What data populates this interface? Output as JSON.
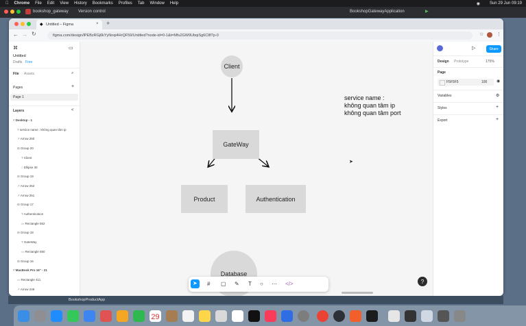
{
  "menubar": {
    "items": [
      "Chrome",
      "File",
      "Edit",
      "View",
      "History",
      "Bookmarks",
      "Profiles",
      "Tab",
      "Window",
      "Help"
    ],
    "status_app": "BookshopGatewayApplication",
    "clock": "Sun 29 Jun 09:19"
  },
  "ide": {
    "project": "bookshop_gateway",
    "vcs": "Version control"
  },
  "browser": {
    "tab_title": "Untitled – Figma",
    "url": "figma.com/design/lPEBzRGj6kYyNnqi4HrQF59/Untitled?node-id=0-1&t=Mfu2GW9UbqiSg6C8f7p-0"
  },
  "figma": {
    "file_name": "Untitled",
    "drafts": "Drafts",
    "plan": "Free",
    "tabs": [
      "File",
      "Assets"
    ],
    "pages_label": "Pages",
    "page": "Page 1",
    "layers_label": "Layers",
    "layers": [
      "Desktop - 1",
      "service name : không quan tâm ip",
      "Arrow 250",
      "Group 20",
      "Client",
      "Ellipse 30",
      "Group 19",
      "Arrow 252",
      "Arrow 251",
      "Group 17",
      "Authentication",
      "Rectangle 552",
      "Group 18",
      "GateWay",
      "Rectangle 550",
      "Group 16",
      "MacBook Pro 16\" - 21",
      "Rectangle 411",
      "Arrow 249"
    ],
    "right": {
      "tabs": [
        "Design",
        "Prototype"
      ],
      "zoom": "175%",
      "share": "Share",
      "page_label": "Page",
      "color": "F5F5F5",
      "opacity": "100",
      "variables": "Variables",
      "styles": "Styles",
      "export": "Export"
    }
  },
  "diagram": {
    "client": "Client",
    "gateway": "GateWay",
    "product": "Product",
    "authentication": "Authentication",
    "database": "Database",
    "note": "service name :\nkhông quan tâm ip\nkhông quan tâm port"
  },
  "dock": {
    "bar_app": "BookshopProductApp"
  }
}
